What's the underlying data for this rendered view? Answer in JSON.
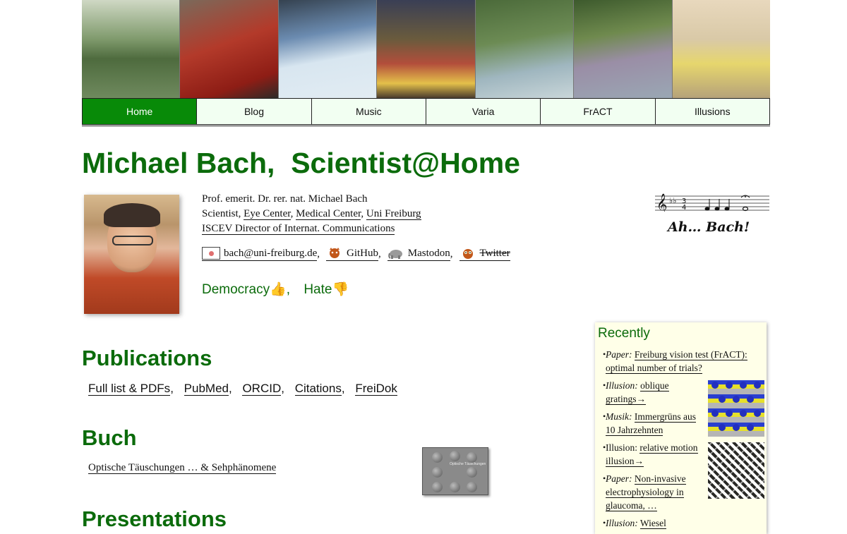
{
  "banner": {
    "photos": [
      "garden-pond-photo",
      "guitar-red-shirt-photo",
      "kayak-whitewater-photo",
      "lecture-flowers-photo",
      "waterski-photo",
      "couple-photo",
      "acoustic-guitar-photo"
    ]
  },
  "nav": {
    "tabs": [
      {
        "label": "Home"
      },
      {
        "label": "Blog"
      },
      {
        "label": "Music"
      },
      {
        "label": "Varia"
      },
      {
        "label": "FrACT"
      },
      {
        "label": "Illusions"
      }
    ]
  },
  "colors": {
    "accent": "#0b6b0b",
    "active_tab": "#088a08",
    "tab_bg": "#f2fff2",
    "recent_bg": "#ffffe8"
  },
  "header": {
    "title": "Michael Bach,  Scientist@Home"
  },
  "info": {
    "line1": "Prof. emerit. Dr. rer. nat. Michael Bach",
    "line2_prefix": "Scientist, ",
    "eye_center": "Eye Center",
    "medical_center": "Medical Center",
    "uni_freiburg": "Uni Freiburg",
    "iscev": "ISCEV Director of Internat. Communications",
    "sep": ",  "
  },
  "contacts": {
    "email": "bach@uni-freiburg.de",
    "github": "GitHub",
    "mastodon": "Mastodon",
    "twitter": "Twitter",
    "sep": ","
  },
  "democracy": {
    "democracy": "Democracy",
    "democracy_icon": "👍",
    "hate": "Hate",
    "hate_icon": "👎",
    "sep": ","
  },
  "bach_logo": {
    "text": "Ah… Bach!"
  },
  "publications": {
    "heading": "Publications",
    "links": [
      "Full list & PDFs",
      "PubMed",
      "ORCID",
      "Citations",
      "FreiDok"
    ],
    "sep": ","
  },
  "buch": {
    "heading": "Buch",
    "link": "Optische Täuschungen … & Sehphänomene",
    "book_title": "Optische Täuschungen"
  },
  "presentations": {
    "heading": "Presentations"
  },
  "recently": {
    "heading": "Recently",
    "items": [
      {
        "kind": "Paper:",
        "text": "Freiburg vision test (FrACT): optimal number of trials?"
      },
      {
        "kind": "Illusion:",
        "text": "oblique gratings→"
      },
      {
        "kind": "Musik:",
        "text": "Immergrüns aus 10 Jahrzehnten"
      },
      {
        "kind": "Illusion:",
        "text": "relative motion illusion→"
      },
      {
        "kind": "Paper:",
        "text": "Non-invasive electrophysiology in glaucoma, …"
      },
      {
        "kind": "Illusion:",
        "text": "Wiesel"
      }
    ]
  }
}
